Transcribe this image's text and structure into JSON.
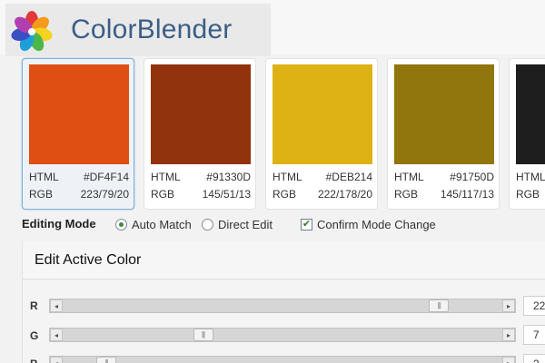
{
  "app": {
    "title": "ColorBlender"
  },
  "swatches": [
    {
      "color": "#DF4F14",
      "html_label": "HTML",
      "html_value": "#DF4F14",
      "rgb_label": "RGB",
      "rgb_value": "223/79/20",
      "active": true
    },
    {
      "color": "#91330D",
      "html_label": "HTML",
      "html_value": "#91330D",
      "rgb_label": "RGB",
      "rgb_value": "145/51/13",
      "active": false
    },
    {
      "color": "#DEB214",
      "html_label": "HTML",
      "html_value": "#DEB214",
      "rgb_label": "RGB",
      "rgb_value": "222/178/20",
      "active": false
    },
    {
      "color": "#91750D",
      "html_label": "HTML",
      "html_value": "#91750D",
      "rgb_label": "RGB",
      "rgb_value": "145/117/13",
      "active": false
    },
    {
      "color": "#1E1E1E",
      "html_label": "HTML",
      "html_value": "",
      "rgb_label": "RGB",
      "rgb_value": "",
      "active": false
    }
  ],
  "editing_mode": {
    "label": "Editing Mode",
    "options": [
      {
        "label": "Auto Match",
        "selected": true
      },
      {
        "label": "Direct Edit",
        "selected": false
      }
    ],
    "confirm": {
      "label": "Confirm Mode Change",
      "checked": true
    }
  },
  "edit_panel": {
    "title": "Edit Active Color",
    "channels": [
      {
        "label": "R",
        "value": 223,
        "max": 255,
        "value_text": "22"
      },
      {
        "label": "G",
        "value": 79,
        "max": 255,
        "value_text": "7"
      },
      {
        "label": "B",
        "value": 20,
        "max": 255,
        "value_text": "2"
      }
    ]
  },
  "icons": {
    "slider_left": "◂",
    "slider_right": "▸",
    "thumb_grip": "|||",
    "check_mark": "✔"
  }
}
